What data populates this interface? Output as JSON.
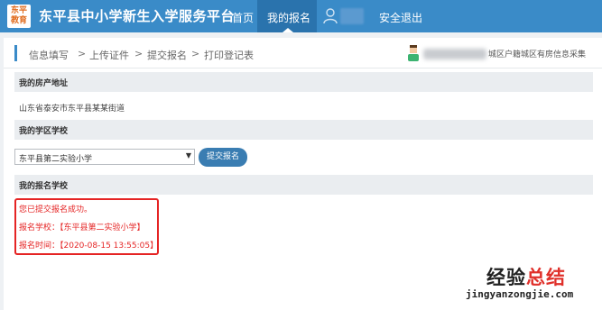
{
  "header": {
    "logo_line1": "东平",
    "logo_line2": "教育",
    "site_title": "东平县中小学新生入学服务平台",
    "nav": [
      {
        "label": "首页"
      },
      {
        "label": "我的报名"
      }
    ],
    "logout_label": "安全退出",
    "colors": {
      "bar": "#3a8bc8",
      "active": "#2a73ad"
    }
  },
  "breadcrumb": {
    "steps": [
      "信息填写",
      "上传证件",
      "提交报名",
      "打印登记表"
    ],
    "separator": ">",
    "user_category": "城区户籍城区有房信息采集"
  },
  "sections": {
    "property": {
      "title": "我的房产地址",
      "value": "山东省泰安市东平县某某街道"
    },
    "district_school": {
      "title": "我的学区学校",
      "selected_option": "东平县第二实验小学",
      "submit_label": "提交报名"
    },
    "registered_school": {
      "title": "我的报名学校",
      "result_lines": [
        "您已提交报名成功。",
        "报名学校：【东平县第二实验小学】",
        "报名时间：【2020-08-15 13:55:05】"
      ],
      "result_color": "#e52424"
    }
  },
  "watermark": {
    "main_left": "经验",
    "main_right": "总结",
    "sub": "jingyanzongjie.com"
  }
}
